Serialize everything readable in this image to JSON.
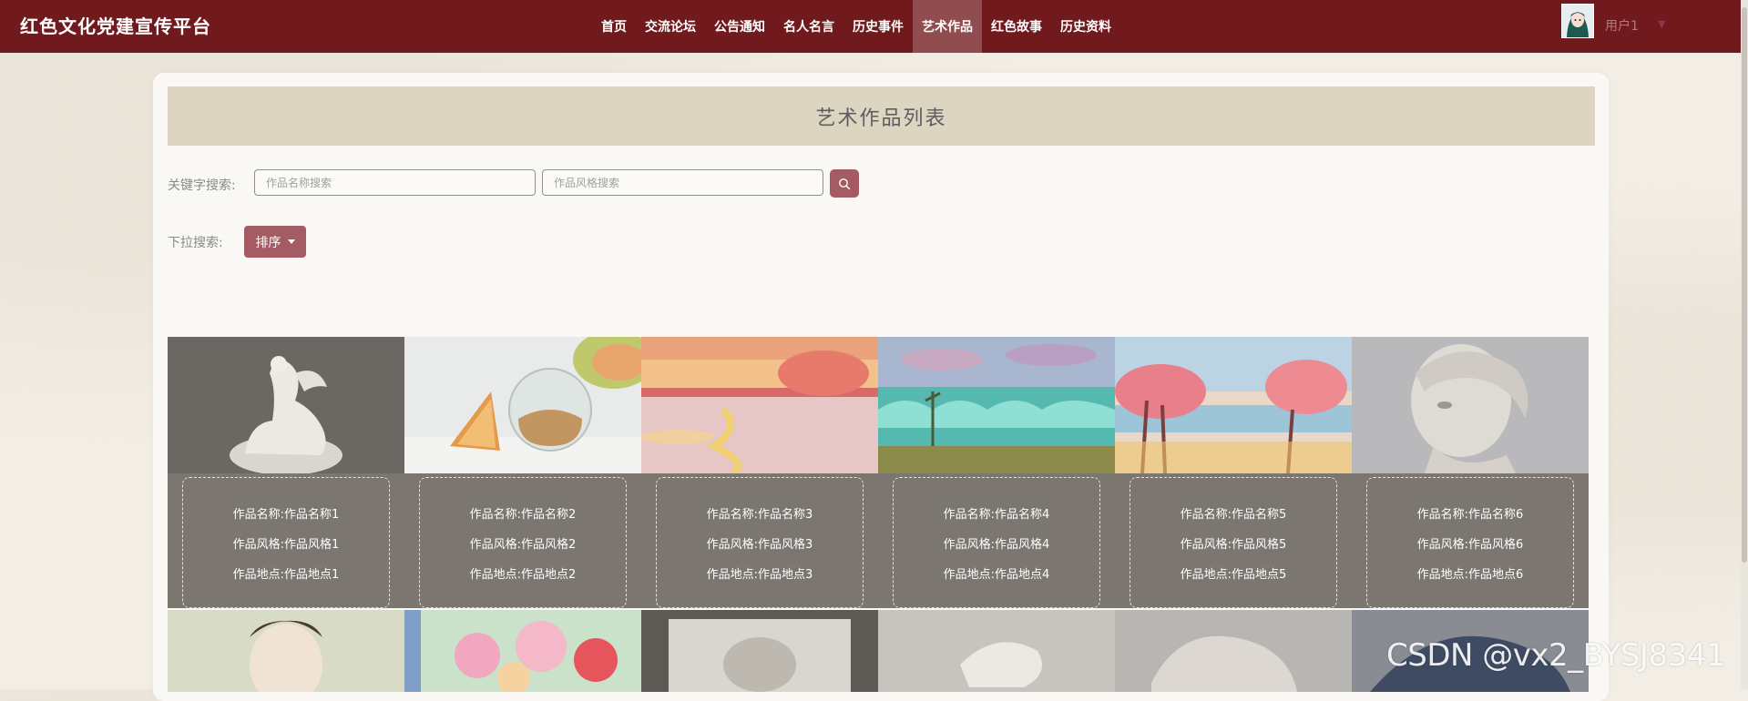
{
  "brand": "红色文化党建宣传平台",
  "nav": {
    "items": [
      "首页",
      "交流论坛",
      "公告通知",
      "名人名言",
      "历史事件",
      "艺术作品",
      "红色故事",
      "历史资料"
    ],
    "active": "艺术作品"
  },
  "user": {
    "name": "用户1"
  },
  "page": {
    "title": "艺术作品列表"
  },
  "search": {
    "label": "关键字搜索:",
    "name_placeholder": "作品名称搜索",
    "style_placeholder": "作品风格搜索",
    "button_icon": "search-icon"
  },
  "filter": {
    "label": "下拉搜索:",
    "sort_label": "排序"
  },
  "artworks": [
    {
      "name": "作品名称:作品名称1",
      "style": "作品风格:作品风格1",
      "place": "作品地点:作品地点1",
      "image": "white statue"
    },
    {
      "name": "作品名称:作品名称2",
      "style": "作品风格:作品风格2",
      "place": "作品地点:作品地点2",
      "image": "melon and glass still life"
    },
    {
      "name": "作品名称:作品名称3",
      "style": "作品风格:作品风格3",
      "place": "作品地点:作品地点3",
      "image": "sunset landscape"
    },
    {
      "name": "作品名称:作品名称4",
      "style": "作品风格:作品风格4",
      "place": "作品地点:作品地点4",
      "image": "teal waves landscape"
    },
    {
      "name": "作品名称:作品名称5",
      "style": "作品风格:作品风格5",
      "place": "作品地点:作品地点5",
      "image": "pink trees lakeside"
    },
    {
      "name": "作品名称:作品名称6",
      "style": "作品风格:作品风格6",
      "place": "作品地点:作品地点6",
      "image": "marble bust"
    }
  ],
  "watermark": "CSDN @vx2_BYSJ8341",
  "colors": {
    "navbar": "#711a1e",
    "accent_button": "#a55b64",
    "title_bar": "#dcd5c2",
    "info_panel": "#7b7770"
  }
}
